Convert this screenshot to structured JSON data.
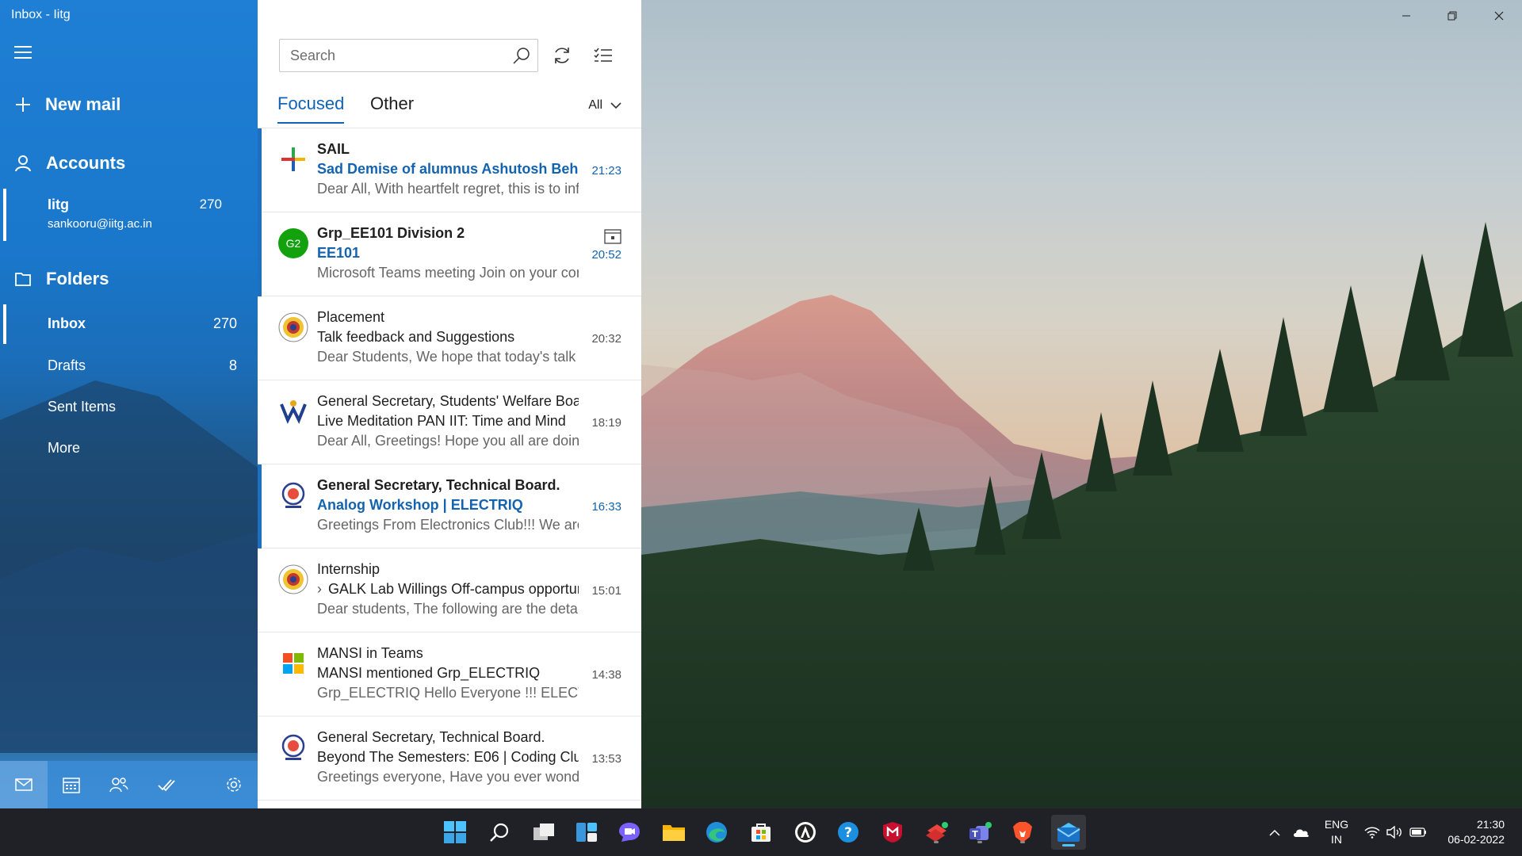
{
  "window": {
    "title": "Inbox - Iitg",
    "controls": {
      "minimize": "minimize-icon",
      "maximize": "restore-icon",
      "close": "close-icon"
    }
  },
  "nav": {
    "new_mail_label": "New mail",
    "accounts_label": "Accounts",
    "account": {
      "name": "Iitg",
      "email": "sankooru@iitg.ac.in",
      "count": "270"
    },
    "folders_label": "Folders",
    "folders": [
      {
        "label": "Inbox",
        "count": "270",
        "active": true
      },
      {
        "label": "Drafts",
        "count": "8",
        "active": false
      },
      {
        "label": "Sent Items",
        "count": "",
        "active": false
      },
      {
        "label": "More",
        "count": "",
        "active": false
      }
    ],
    "bottom_icons": [
      "mail-icon",
      "calendar-icon",
      "people-icon",
      "todo-icon",
      "settings-icon"
    ]
  },
  "list": {
    "search_placeholder": "Search",
    "tabs": {
      "focused": "Focused",
      "other": "Other"
    },
    "filter": "All",
    "messages": [
      {
        "sender": "SAIL",
        "subject": "Sad Demise of alumnus Ashutosh Behera",
        "preview": "Dear All, With heartfelt regret, this is to inform",
        "time": "21:23",
        "unread": true,
        "avatar": "sail-logo"
      },
      {
        "sender": "Grp_EE101 Division 2",
        "subject": "EE101",
        "preview": "Microsoft Teams meeting Join on your computer",
        "time": "20:52",
        "unread": true,
        "avatar": "G2",
        "avatar_color": "#13a10e",
        "has_calendar": true
      },
      {
        "sender": "Placement",
        "subject": "Talk feedback and Suggestions",
        "preview": "Dear Students, We hope that today's talk",
        "time": "20:32",
        "unread": false,
        "avatar": "iitg-logo"
      },
      {
        "sender": "General Secretary, Students' Welfare Board",
        "subject": "Live Meditation PAN IIT: Time and Mind",
        "preview": "Dear All, Greetings! Hope you all are doing",
        "time": "18:19",
        "unread": false,
        "avatar": "swb-logo"
      },
      {
        "sender": "General Secretary, Technical Board.",
        "subject": "Analog Workshop | ELECTRIQ",
        "preview": "Greetings From Electronics Club!!! We are",
        "time": "16:33",
        "unread": true,
        "avatar": "techboard-logo"
      },
      {
        "sender": "Internship",
        "subject": "GALK Lab Willings Off-campus opportunity",
        "preview": "Dear students, The following are the details",
        "time": "15:01",
        "unread": false,
        "avatar": "iitg-logo",
        "has_arrow": true
      },
      {
        "sender": "MANSI in Teams",
        "subject": "MANSI mentioned Grp_ELECTRIQ",
        "preview": "Grp_ELECTRIQ Hello Everyone !!! ELECTRIQ",
        "time": "14:38",
        "unread": false,
        "avatar": "microsoft-logo"
      },
      {
        "sender": "General Secretary, Technical Board.",
        "subject": "Beyond The Semesters: E06 | Coding Club",
        "preview": "Greetings everyone, Have you ever wondered",
        "time": "13:53",
        "unread": false,
        "avatar": "techboard-logo"
      }
    ]
  },
  "taskbar": {
    "apps": [
      "windows-start-icon",
      "search-icon",
      "task-view-icon",
      "widgets-icon",
      "chat-icon",
      "file-explorer-icon",
      "edge-icon",
      "store-icon",
      "app-icon",
      "help-icon",
      "mcafee-icon",
      "anydesk-icon",
      "teams-icon",
      "brave-icon",
      "mail-icon"
    ],
    "language": {
      "line1": "ENG",
      "line2": "IN"
    },
    "clock": {
      "time": "21:30",
      "date": "06-02-2022"
    }
  }
}
